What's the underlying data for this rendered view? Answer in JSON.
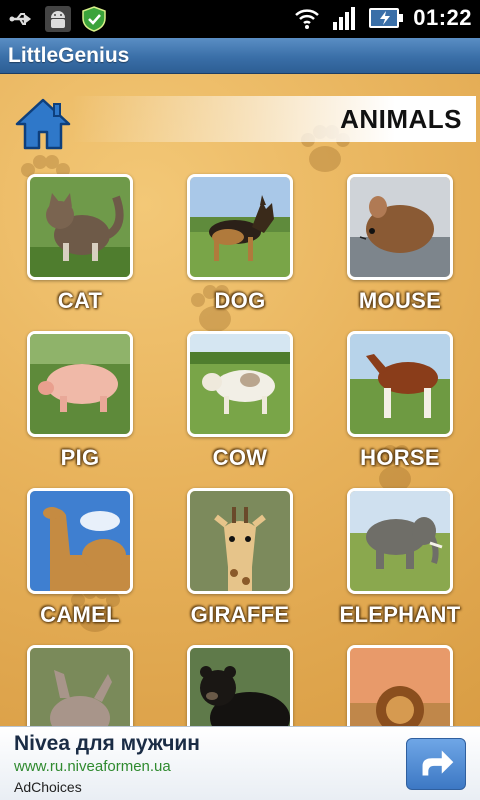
{
  "status_bar": {
    "time": "01:22",
    "icons": [
      "usb-icon",
      "android-debug-icon",
      "security-shield-icon",
      "wifi-icon",
      "signal-icon",
      "battery-charging-icon"
    ]
  },
  "app": {
    "title": "LittleGenius"
  },
  "header": {
    "title": "ANIMALS",
    "home_icon": "home-icon"
  },
  "animals": [
    {
      "label": "CAT"
    },
    {
      "label": "DOG"
    },
    {
      "label": "MOUSE"
    },
    {
      "label": "PIG"
    },
    {
      "label": "COW"
    },
    {
      "label": "HORSE"
    },
    {
      "label": "CAMEL"
    },
    {
      "label": "GIRAFFE"
    },
    {
      "label": "ELEPHANT"
    },
    {
      "label": ""
    },
    {
      "label": ""
    },
    {
      "label": ""
    }
  ],
  "ad": {
    "title": "Nivea для мужчин",
    "url": "www.ru.niveaformen.ua",
    "choices": "AdChoices",
    "button_icon": "arrow-right-icon"
  },
  "colors": {
    "title_bar": "#3a6fa8",
    "background": "#e8b35c",
    "label_text": "#ffffff",
    "ad_url": "#2f8a2f"
  }
}
